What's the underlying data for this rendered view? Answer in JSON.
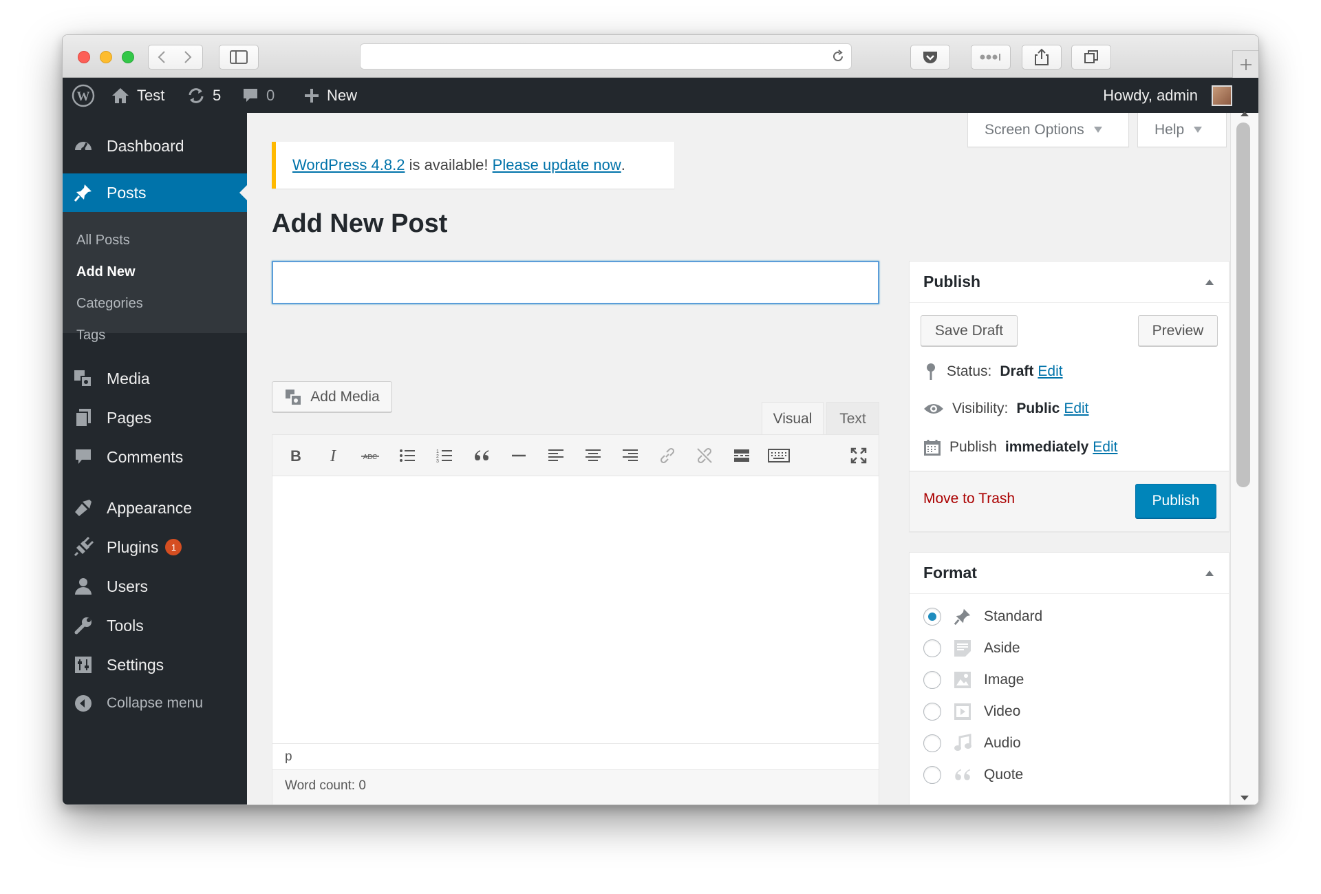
{
  "browser": {
    "url": ""
  },
  "admin_bar": {
    "site_name": "Test",
    "updates_count": "5",
    "comments_count": "0",
    "new_label": "New",
    "howdy": "Howdy, admin"
  },
  "sidebar": {
    "items": [
      {
        "label": "Dashboard",
        "icon": "dashboard-icon"
      },
      {
        "label": "Posts",
        "icon": "pin-icon",
        "current": true
      },
      {
        "label": "Media",
        "icon": "media-icon"
      },
      {
        "label": "Pages",
        "icon": "pages-icon"
      },
      {
        "label": "Comments",
        "icon": "comment-icon"
      },
      {
        "label": "Appearance",
        "icon": "brush-icon"
      },
      {
        "label": "Plugins",
        "icon": "plugin-icon",
        "badge": "1"
      },
      {
        "label": "Users",
        "icon": "user-icon"
      },
      {
        "label": "Tools",
        "icon": "wrench-icon"
      },
      {
        "label": "Settings",
        "icon": "settings-icon"
      }
    ],
    "submenu": [
      "All Posts",
      "Add New",
      "Categories",
      "Tags"
    ],
    "collapse_label": "Collapse menu"
  },
  "top_tabs": {
    "screen_options": "Screen Options",
    "help": "Help"
  },
  "notice": {
    "link1": "WordPress 4.8.2",
    "middle": " is available! ",
    "link2": "Please update now",
    "end": "."
  },
  "page_title": "Add New Post",
  "title_input": {
    "value": "",
    "placeholder": ""
  },
  "editor": {
    "add_media": "Add Media",
    "tab_visual": "Visual",
    "tab_text": "Text",
    "path": "p",
    "word_count": "Word count: 0"
  },
  "publish_box": {
    "title": "Publish",
    "save_draft": "Save Draft",
    "preview": "Preview",
    "status_label": "Status:",
    "status_value": "Draft",
    "visibility_label": "Visibility:",
    "visibility_value": "Public",
    "publish_label": "Publish",
    "publish_value": "immediately",
    "edit": "Edit",
    "trash": "Move to Trash",
    "publish_button": "Publish"
  },
  "format_box": {
    "title": "Format",
    "options": [
      {
        "label": "Standard",
        "selected": true
      },
      {
        "label": "Aside"
      },
      {
        "label": "Image"
      },
      {
        "label": "Video"
      },
      {
        "label": "Audio"
      },
      {
        "label": "Quote"
      }
    ]
  },
  "colors": {
    "admin_bar": "#23282d",
    "accent": "#0073aa",
    "notice_border": "#ffb900",
    "badge": "#d54e21",
    "trash": "#a00000"
  }
}
